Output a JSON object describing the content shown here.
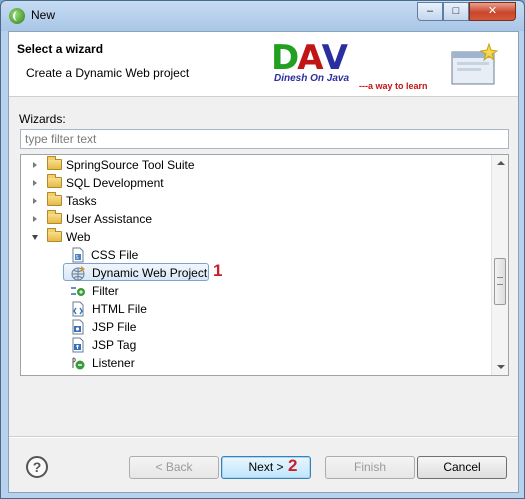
{
  "window": {
    "title": "New",
    "controls": {
      "minimize": "–",
      "maximize": "□",
      "close": "✕"
    }
  },
  "banner": {
    "title": "Select a wizard",
    "description": "Create a Dynamic Web project",
    "logo": {
      "letters": [
        "D",
        "A",
        "V"
      ],
      "letter_colors": [
        "#22a022",
        "#c01616",
        "#2a2e9e"
      ],
      "subtitle": "Dinesh On Java",
      "tagline": "---a way to learn"
    }
  },
  "wizards_label": "Wizards:",
  "filter": {
    "placeholder": "type filter text",
    "value": ""
  },
  "tree": {
    "folders": [
      {
        "label": "SpringSource Tool Suite",
        "expanded": false
      },
      {
        "label": "SQL Development",
        "expanded": false
      },
      {
        "label": "Tasks",
        "expanded": false
      },
      {
        "label": "User Assistance",
        "expanded": false
      },
      {
        "label": "Web",
        "expanded": true
      }
    ],
    "web_items": [
      {
        "label": "CSS File",
        "icon": "css-file-icon"
      },
      {
        "label": "Dynamic Web Project",
        "icon": "dynamic-web-project-icon",
        "selected": true
      },
      {
        "label": "Filter",
        "icon": "filter-icon"
      },
      {
        "label": "HTML File",
        "icon": "html-file-icon"
      },
      {
        "label": "JSP File",
        "icon": "jsp-file-icon"
      },
      {
        "label": "JSP Tag",
        "icon": "jsp-tag-icon"
      },
      {
        "label": "Listener",
        "icon": "listener-icon"
      }
    ]
  },
  "annotations": {
    "step1": "1",
    "step2": "2"
  },
  "buttons": {
    "help": "?",
    "back": "< Back",
    "next": "Next >",
    "finish": "Finish",
    "cancel": "Cancel"
  },
  "colors": {
    "annotation": "#c8202a",
    "selection_border": "#7da2ce"
  }
}
